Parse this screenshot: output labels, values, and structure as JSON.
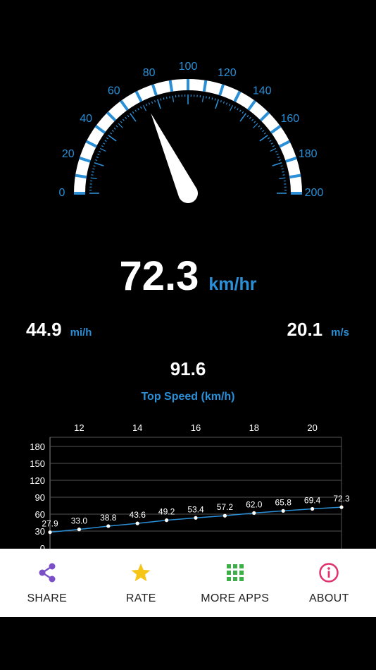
{
  "colors": {
    "background": "#000000",
    "accent": "#2a8fd6",
    "text": "#ffffff",
    "share": "#7b4fc8",
    "rate": "#f5c518",
    "more_apps": "#3fae49",
    "about": "#e0326e"
  },
  "speedometer": {
    "min": 0,
    "max": 200,
    "labels": [
      "0",
      "20",
      "40",
      "60",
      "80",
      "100",
      "120",
      "140",
      "160",
      "180",
      "200"
    ],
    "needle_value": 72.3
  },
  "speed": {
    "kmh": "72.3",
    "kmh_unit": "km/hr",
    "mph": "44.9",
    "mph_unit": "mi/h",
    "ms": "20.1",
    "ms_unit": "m/s"
  },
  "top_speed": {
    "value": "91.6",
    "label": "Top Speed (km/h)"
  },
  "chart_data": {
    "type": "line",
    "x": [
      11,
      12,
      13,
      14,
      15,
      16,
      17,
      18,
      19,
      20,
      21
    ],
    "x_tick_labels": [
      "12",
      "14",
      "16",
      "18",
      "20"
    ],
    "y_tick_labels": [
      "0",
      "30",
      "60",
      "90",
      "120",
      "150",
      "180"
    ],
    "series": [
      {
        "values": [
          27.9,
          33.0,
          38.8,
          43.6,
          49.2,
          53.4,
          57.2,
          62.0,
          65.8,
          69.4,
          72.3
        ],
        "point_labels": [
          "27.9",
          "33.0",
          "38.8",
          "43.6",
          "49.2",
          "53.4",
          "57.2",
          "62.0",
          "65.8",
          "69.4",
          "72.3"
        ],
        "color": "#2a8fd6"
      }
    ],
    "xlim": [
      11,
      21
    ],
    "ylim": [
      0,
      180
    ],
    "grid": true,
    "xaxis_position": "top"
  },
  "tabs": [
    {
      "label": "SHARE",
      "icon": "share-icon"
    },
    {
      "label": "RATE",
      "icon": "star-icon"
    },
    {
      "label": "MORE APPS",
      "icon": "grid-icon"
    },
    {
      "label": "ABOUT",
      "icon": "info-icon"
    }
  ]
}
